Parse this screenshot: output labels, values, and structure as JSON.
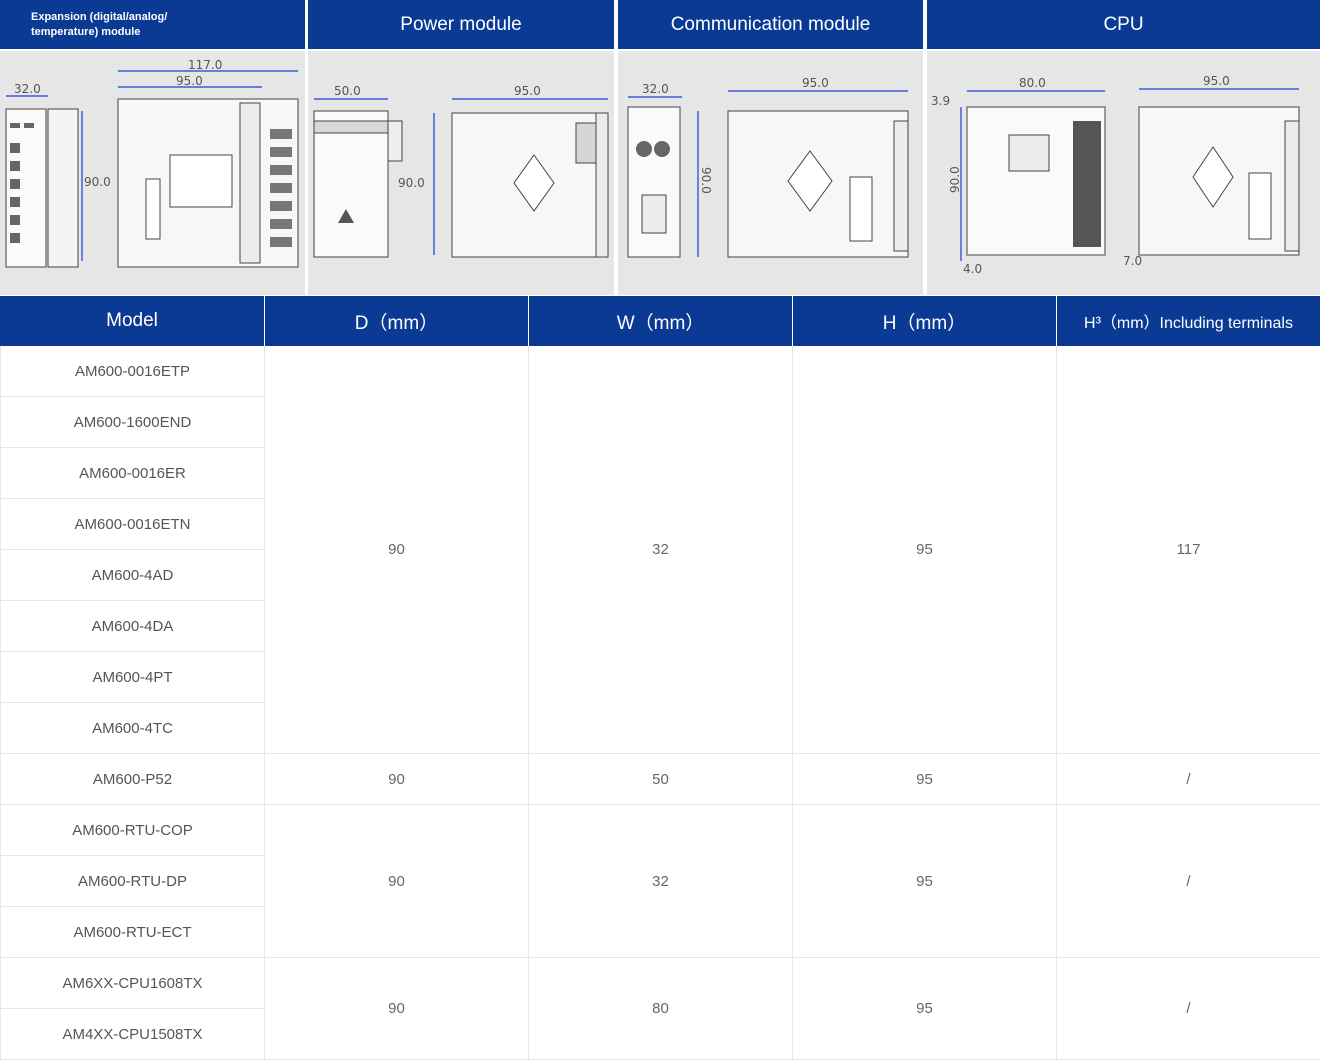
{
  "panels": [
    {
      "title": "Expansion (digital/analog/ temperature) module",
      "dims": [
        "32.0",
        "117.0",
        "95.0",
        "90.0"
      ]
    },
    {
      "title": "Power module",
      "dims": [
        "50.0",
        "95.0",
        "90.0"
      ]
    },
    {
      "title": "Communication module",
      "dims": [
        "32.0",
        "95.0",
        "90.0"
      ]
    },
    {
      "title": "CPU",
      "dims": [
        "80.0",
        "95.0",
        "3.9",
        "90.0",
        "4.0",
        "7.0"
      ]
    }
  ],
  "table": {
    "headers": [
      "Model",
      "D（mm）",
      "W（mm）",
      "H（mm）",
      "H³（mm）Including terminals"
    ],
    "groups": [
      {
        "models": [
          "AM600-0016ETP",
          "AM600-1600END",
          "AM600-0016ER",
          "AM600-0016ETN",
          "AM600-4AD",
          "AM600-4DA",
          "AM600-4PT",
          "AM600-4TC"
        ],
        "d": "90",
        "w": "32",
        "h": "95",
        "h3": "117"
      },
      {
        "models": [
          "AM600-P52"
        ],
        "d": "90",
        "w": "50",
        "h": "95",
        "h3": "/"
      },
      {
        "models": [
          "AM600-RTU-COP",
          "AM600-RTU-DP",
          "AM600-RTU-ECT"
        ],
        "d": "90",
        "w": "32",
        "h": "95",
        "h3": "/"
      },
      {
        "models": [
          "AM6XX-CPU1608TX",
          "AM4XX-CPU1508TX"
        ],
        "d": "90",
        "w": "80",
        "h": "95",
        "h3": "/"
      }
    ]
  },
  "colors": {
    "header_bg": "#0b3a94",
    "grid": "#e6e6e6",
    "drawing_bg": "#e6e6e6"
  }
}
